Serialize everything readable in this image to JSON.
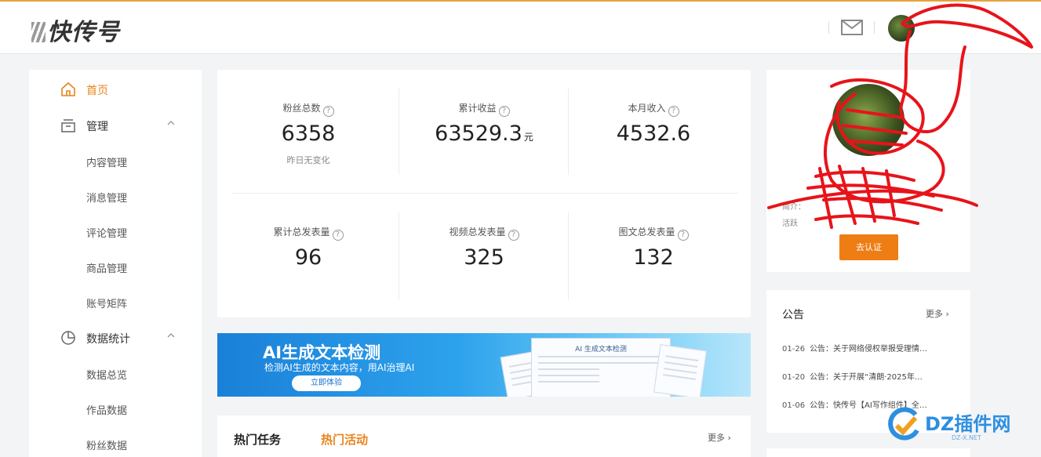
{
  "header": {
    "logo_text": "快传号",
    "mail_icon": "mail-icon",
    "avatar": "user-avatar"
  },
  "sidebar": {
    "home": "首页",
    "manage": "管理",
    "manage_items": [
      "内容管理",
      "消息管理",
      "评论管理",
      "商品管理",
      "账号矩阵"
    ],
    "stats": "数据统计",
    "stats_items": [
      "数据总览",
      "作品数据",
      "粉丝数据"
    ]
  },
  "stats": {
    "fans_total": {
      "title": "粉丝总数",
      "value": "6358",
      "sub": "昨日无变化"
    },
    "income_total": {
      "title": "累计收益",
      "value": "63529.3",
      "unit": "元"
    },
    "month_income": {
      "title": "本月收入",
      "value": "4532.6"
    },
    "posts_total": {
      "title": "累计总发表量",
      "value": "96"
    },
    "video_total": {
      "title": "视频总发表量",
      "value": "325"
    },
    "article_total": {
      "title": "图文总发表量",
      "value": "132"
    },
    "help_mark": "?"
  },
  "banner": {
    "title": "AI生成文本检测",
    "subtitle": "检测AI生成的文本内容，用AI治理AI",
    "button": "立即体验",
    "doc_title": "AI 生成文本检测"
  },
  "tasks": {
    "tab_tasks": "热门任务",
    "tab_activities": "热门活动",
    "more": "更多"
  },
  "profile": {
    "intro_label": "简介：",
    "intro_label2": "活跃",
    "cert_button": "去认证"
  },
  "notice": {
    "title": "公告",
    "more": "更多",
    "rows": [
      {
        "date": "01-26",
        "text": "公告：关于网络侵权举报受理情…"
      },
      {
        "date": "01-20",
        "text": "公告：关于开展“清朗·2025年…"
      },
      {
        "date": "01-06",
        "text": "公告：快传号【AI写作组件】全…"
      }
    ]
  },
  "watermark": {
    "text": "DZ插件网",
    "sub": "DZ-X.NET"
  },
  "colors": {
    "accent": "#e8841a",
    "button": "#ee7d14",
    "scribble": "#e8131a"
  }
}
